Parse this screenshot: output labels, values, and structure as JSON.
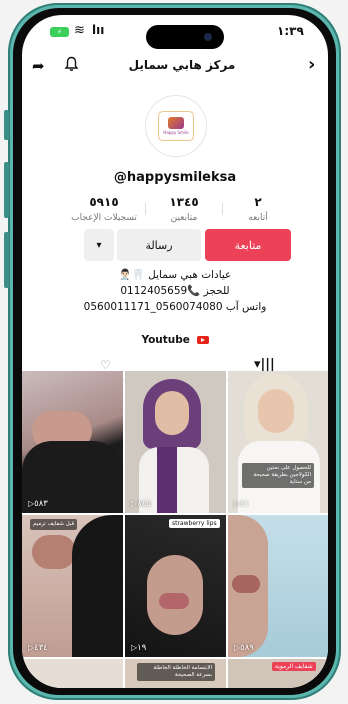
{
  "status": {
    "time": "١:٣٩",
    "battery_glyph": "⚡",
    "wifi_glyph": "≋",
    "signal_glyph": "lıı"
  },
  "header": {
    "title": "مركز هابي سمايل",
    "share_glyph": "➦",
    "bell_glyph": "🔔",
    "back_glyph": "›"
  },
  "profile": {
    "username": "@happysmileksa",
    "logo_text": "Happy Smile",
    "stats": [
      {
        "num": "٥٩١٥",
        "label": "تسجيلات الإعجاب"
      },
      {
        "num": "١٣٤٥",
        "label": "متابعين"
      },
      {
        "num": "٢",
        "label": "أتابعه"
      }
    ],
    "follow_label": "متابعة",
    "message_label": "رسالة",
    "more_glyph": "▾",
    "bio": [
      "عيادات هبي سمايل 🦷👨🏻‍⚕️",
      "للحجز 📞0112405659",
      "واتس آب 0560074080_0560011171"
    ],
    "youtube_label": "Youtube"
  },
  "tabs": {
    "liked_glyph": "♡",
    "videos_glyph": "▾|||"
  },
  "grid": [
    {
      "count": "٥٨٣",
      "caption": "",
      "tag": ""
    },
    {
      "count": "٨٤٥",
      "caption": "",
      "tag": ""
    },
    {
      "count": "٤١",
      "caption": "للحصول على نحتين الكولاجين بطريقة صحيحة من ستاية",
      "tag": ""
    },
    {
      "count": "٤٣٤",
      "caption": "قبل شفايف ترميم",
      "tag": ""
    },
    {
      "count": "١٩",
      "caption": "",
      "tag": "strawberry lips"
    },
    {
      "count": "٥٨٩",
      "caption": "",
      "tag": ""
    },
    {
      "count": "",
      "caption": "الابتسامة الخاطئة الخاطئة بسرعة الصحيحة",
      "tag": ""
    },
    {
      "count": "",
      "caption": "",
      "tag": "شفايف الرموية"
    }
  ],
  "colors": {
    "accent": "#ec4156",
    "frame": "#5bb6ad"
  }
}
